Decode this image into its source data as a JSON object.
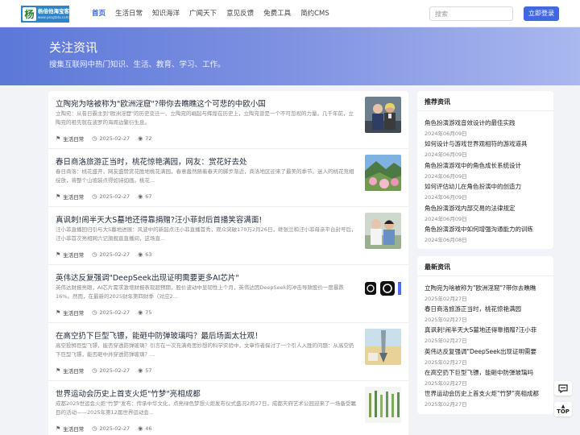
{
  "header": {
    "logo_char": "杨",
    "logo_name": "杨倍他海宝客",
    "logo_url": "www.yangtata.com",
    "nav": [
      "首页",
      "生活日常",
      "知识海洋",
      "广闻天下",
      "意见反馈",
      "免费工具",
      "简约CMS"
    ],
    "search_placeholder": "搜索",
    "login_label": "立即登录"
  },
  "banner": {
    "title": "关注资讯",
    "subtitle": "搜集互联网中热门知识、生活、教育、学习、工作。"
  },
  "articles": [
    {
      "title": "立陶宛为啥被称为\"欧洲淫窟\"?带你去瞧瞧这个可悲的中欧小国",
      "desc": "立陶宛：从昔日霸主到\"欧洲淫窟\"的历史变迁一、立陶宛的崛起与辉煌在历史上，立陶宛曾是一个不可忽视的力量。几千年前，立陶宛的祖先就在波罗的海周边繁衍生息。",
      "category": "生活日常",
      "date": "2025-02-27",
      "views": "72",
      "thumb": "people-photo"
    },
    {
      "title": "春日商洛旅游正当时，桃花惊艳满园，网友：赏花好去处",
      "desc": "春日商洛：桃花盛开，网友盛赞赏花胜地桃花满园，春意盎然随着春天的脚步渐近，商洛地区迎来了最美的季节。迷人的桃花竞相绽放，将整个山坡装点得如诗如画。桃花...",
      "category": "生活日常",
      "date": "2025-02-27",
      "views": "67",
      "thumb": "landscape-photo"
    },
    {
      "title": "真讽刺!闹半天大S墓地还得靠捐赠?汪小菲封后首播笑容满面!",
      "desc": "汪小菲直播回归引与大S墓地进展：风波中的新起点汪小菲直播首秀，观众突破170万2月26日，继张兰和汪小菲母亲平台封号后，汪小菲首次亮相网六记旗舰直直播间，这场直...",
      "category": "生活日常",
      "date": "2025-02-27",
      "views": "63",
      "thumb": "couple-photo"
    },
    {
      "title": "英伟达反复强调\"DeepSeek出现证明需要更多AI芯片\"",
      "desc": "英伟达财报亮眼，AI芯片需求激增财报表现超预期，股价波动中显韧性上个月，英伟达因DeepSeek的冲击导致股价一度暴跌16%。然而，在最新的2025财年第四财季（对应2...",
      "category": "生活日常",
      "date": "2025-02-27",
      "views": "75",
      "thumb": "app-icons"
    },
    {
      "title": "在高空扔下巨型飞镖，能砸中防弹玻璃吗？最后场面太壮观！",
      "desc": "高空投掷巨型飞镖，能否穿透防弹玻璃？引言在一次充满奇思妙想的科学实验中，文章作者探讨了一个引人入胜的问题：从高空扔下巨型飞镖，能否砸中并穿透防弹玻璃？...",
      "category": "生活日常",
      "date": "2025-02-27",
      "views": "57",
      "thumb": "sky-photo"
    },
    {
      "title": "世界运动会历史上首支火炬\"竹梦\"亮相成都",
      "desc": "成都2025世运会火炬\"竹梦\"发布：传承中华文化，点亮绿色梦想火炬发布仪式盛况2月27日，成都天府艺术公园迎来了一场备受瞩目的活动——2025年第12届世界运动会...",
      "category": "生活日常",
      "date": "2025-02-27",
      "views": "46",
      "thumb": "torch-photo"
    }
  ],
  "sidebar_recommend": {
    "title": "推荐资讯",
    "items": [
      {
        "title": "角色扮演游戏音效设计的最佳实践",
        "date": "2024年06月09日"
      },
      {
        "title": "如何设计与游戏世界观相符的游戏道具",
        "date": "2024年06月09日"
      },
      {
        "title": "角色扮演游戏中的角色成长系统设计",
        "date": "2024年06月09日"
      },
      {
        "title": "如何评估幼儿在角色扮演中的创造力",
        "date": "2024年06月09日"
      },
      {
        "title": "角色扮演游戏内部交易的法律规定",
        "date": "2024年06月09日"
      },
      {
        "title": "角色扮演游戏中如何增强沟通能力的训练",
        "date": "2024年06月08日"
      }
    ]
  },
  "sidebar_latest": {
    "title": "最新资讯",
    "items": [
      {
        "title": "立陶宛为啥被称为\"欧洲淫窟\"?带你去瞧瞧",
        "date": "2025年02月27日"
      },
      {
        "title": "春日商洛旅游正当时，桃花惊艳满园",
        "date": "2025年02月27日"
      },
      {
        "title": "真讽刺!闹半天大S墓地还得靠捐赠?汪小菲",
        "date": "2025年02月27日"
      },
      {
        "title": "英伟达反复强调\"DeepSeek出现证明需要",
        "date": "2025年02月27日"
      },
      {
        "title": "在高空扔下巨型飞镖，能砸中防弹玻璃吗",
        "date": "2025年02月27日"
      },
      {
        "title": "世界运动会历史上首支火炬\"竹梦\"亮相成都",
        "date": "2025年02月27日"
      }
    ]
  },
  "floating": {
    "feedback_icon": "chat-icon",
    "top_label": "TOP"
  },
  "colors": {
    "accent": "#4168e1",
    "banner_start": "#5c78d8",
    "banner_end": "#aab8ef"
  }
}
